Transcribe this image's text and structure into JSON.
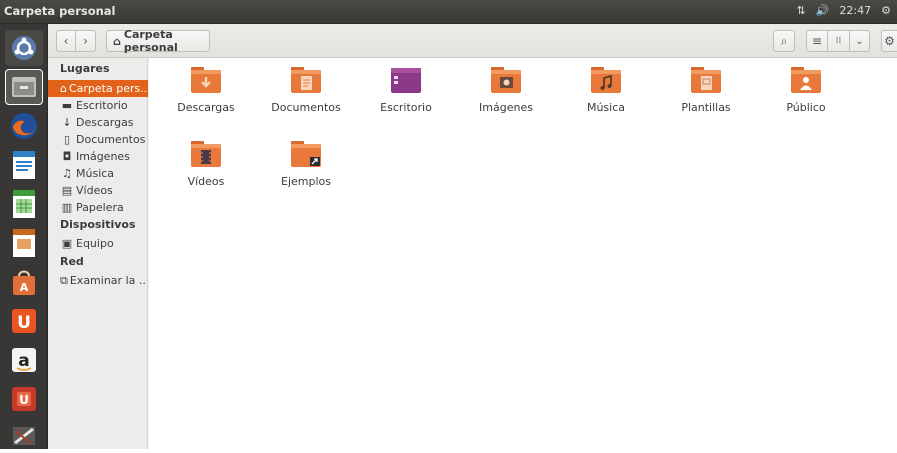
{
  "top_panel": {
    "window_title": "Carpeta personal",
    "clock": "22:47"
  },
  "toolbar": {
    "back_label": "‹",
    "forward_label": "›",
    "path_label": "Carpeta personal"
  },
  "sidebar": {
    "sections": [
      {
        "heading": "Lugares"
      },
      {
        "heading": "Dispositivos"
      },
      {
        "heading": "Red"
      }
    ],
    "places": [
      {
        "label": "Carpeta pers...",
        "icon": "home-icon",
        "active": true
      },
      {
        "label": "Escritorio",
        "icon": "desktop-icon"
      },
      {
        "label": "Descargas",
        "icon": "download-icon"
      },
      {
        "label": "Documentos",
        "icon": "document-icon"
      },
      {
        "label": "Imágenes",
        "icon": "camera-icon"
      },
      {
        "label": "Música",
        "icon": "music-icon"
      },
      {
        "label": "Vídeos",
        "icon": "film-icon"
      },
      {
        "label": "Papelera",
        "icon": "trash-icon"
      }
    ],
    "devices": [
      {
        "label": "Equipo",
        "icon": "computer-icon"
      }
    ],
    "network": [
      {
        "label": "Examinar la ...",
        "icon": "network-icon"
      }
    ]
  },
  "files": [
    {
      "name": "Descargas",
      "icon": "downloads-folder-icon"
    },
    {
      "name": "Documentos",
      "icon": "documents-folder-icon"
    },
    {
      "name": "Escritorio",
      "icon": "desktop-folder-icon"
    },
    {
      "name": "Imágenes",
      "icon": "pictures-folder-icon"
    },
    {
      "name": "Música",
      "icon": "music-folder-icon"
    },
    {
      "name": "Plantillas",
      "icon": "templates-folder-icon"
    },
    {
      "name": "Público",
      "icon": "public-folder-icon"
    },
    {
      "name": "Vídeos",
      "icon": "videos-folder-icon"
    },
    {
      "name": "Ejemplos",
      "icon": "examples-folder-link-icon"
    }
  ],
  "colors": {
    "accent": "#e2621a",
    "folder": "#e8793a",
    "launcher_bg": "#383735"
  }
}
